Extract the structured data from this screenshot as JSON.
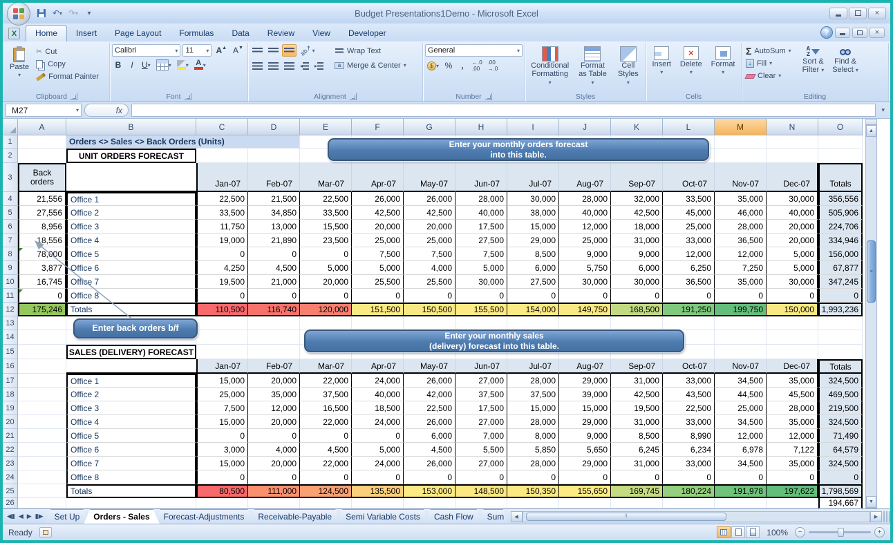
{
  "window": {
    "title": "Budget Presentations1Demo  -  Microsoft Excel"
  },
  "ribbon": {
    "tabs": [
      "Home",
      "Insert",
      "Page Layout",
      "Formulas",
      "Data",
      "Review",
      "View",
      "Developer"
    ],
    "active_tab": "Home",
    "clipboard": {
      "label": "Clipboard",
      "paste": "Paste",
      "cut": "Cut",
      "copy": "Copy",
      "format_painter": "Format Painter"
    },
    "font": {
      "label": "Font",
      "family": "Calibri",
      "size": "11",
      "bold": "B",
      "italic": "I",
      "underline": "U"
    },
    "alignment": {
      "label": "Alignment",
      "wrap": "Wrap Text",
      "merge": "Merge & Center"
    },
    "number": {
      "label": "Number",
      "format": "General"
    },
    "styles": {
      "label": "Styles",
      "conditional_1": "Conditional",
      "conditional_2": "Formatting",
      "table_1": "Format",
      "table_2": "as Table",
      "cellstyles_1": "Cell",
      "cellstyles_2": "Styles"
    },
    "cells": {
      "label": "Cells",
      "insert": "Insert",
      "delete": "Delete",
      "format": "Format"
    },
    "editing": {
      "label": "Editing",
      "autosum": "AutoSum",
      "fill": "Fill",
      "clear": "Clear",
      "sort_1": "Sort &",
      "sort_2": "Filter",
      "find_1": "Find &",
      "find_2": "Select"
    }
  },
  "formula_bar": {
    "name_box": "M27",
    "fx": "fx",
    "formula": ""
  },
  "spreadsheet": {
    "columns": [
      "A",
      "B",
      "C",
      "D",
      "E",
      "F",
      "G",
      "H",
      "I",
      "J",
      "K",
      "L",
      "M",
      "N",
      "O"
    ],
    "selected_column": "M",
    "title_cell": "Orders <> Sales <> Back Orders (Units)",
    "months": [
      "Jan-07",
      "Feb-07",
      "Mar-07",
      "Apr-07",
      "May-07",
      "Jun-07",
      "Jul-07",
      "Aug-07",
      "Sep-07",
      "Oct-07",
      "Nov-07",
      "Dec-07"
    ],
    "totals_header": "Totals",
    "unit_orders": {
      "section_title": "UNIT ORDERS FORECAST",
      "back_orders_header": "Back orders",
      "rows": [
        {
          "office": "Office 1",
          "back_orders": "21,556",
          "values": [
            "22,500",
            "21,500",
            "22,500",
            "26,000",
            "26,000",
            "28,000",
            "30,000",
            "28,000",
            "32,000",
            "33,500",
            "35,000",
            "30,000"
          ],
          "total": "356,556"
        },
        {
          "office": "Office 2",
          "back_orders": "27,556",
          "values": [
            "33,500",
            "34,850",
            "33,500",
            "42,500",
            "42,500",
            "40,000",
            "38,000",
            "40,000",
            "42,500",
            "45,000",
            "46,000",
            "40,000"
          ],
          "total": "505,906"
        },
        {
          "office": "Office 3",
          "back_orders": "8,956",
          "values": [
            "11,750",
            "13,000",
            "15,500",
            "20,000",
            "20,000",
            "17,500",
            "15,000",
            "12,000",
            "18,000",
            "25,000",
            "28,000",
            "20,000"
          ],
          "total": "224,706"
        },
        {
          "office": "Office 4",
          "back_orders": "18,556",
          "values": [
            "19,000",
            "21,890",
            "23,500",
            "25,000",
            "25,000",
            "27,500",
            "29,000",
            "25,000",
            "31,000",
            "33,000",
            "36,500",
            "20,000"
          ],
          "total": "334,946"
        },
        {
          "office": "Office 5",
          "back_orders": "78,000",
          "values": [
            "0",
            "0",
            "0",
            "7,500",
            "7,500",
            "7,500",
            "8,500",
            "9,000",
            "9,000",
            "12,000",
            "12,000",
            "5,000"
          ],
          "total": "156,000"
        },
        {
          "office": "Office 6",
          "back_orders": "3,877",
          "values": [
            "4,250",
            "4,500",
            "5,000",
            "5,000",
            "4,000",
            "5,000",
            "6,000",
            "5,750",
            "6,000",
            "6,250",
            "7,250",
            "5,000"
          ],
          "total": "67,877"
        },
        {
          "office": "Office 7",
          "back_orders": "16,745",
          "values": [
            "19,500",
            "21,000",
            "20,000",
            "25,500",
            "25,500",
            "30,000",
            "27,500",
            "30,000",
            "30,000",
            "36,500",
            "35,000",
            "30,000"
          ],
          "total": "347,245"
        },
        {
          "office": "Office 8",
          "back_orders": "0",
          "values": [
            "0",
            "0",
            "0",
            "0",
            "0",
            "0",
            "0",
            "0",
            "0",
            "0",
            "0",
            "0"
          ],
          "total": "0"
        }
      ],
      "totals": {
        "label": "Totals",
        "back_orders": "175,246",
        "back_orders_color": "#94C75C",
        "values": [
          "110,500",
          "116,740",
          "120,000",
          "151,500",
          "150,500",
          "155,500",
          "154,000",
          "149,750",
          "168,500",
          "191,250",
          "199,750",
          "150,000"
        ],
        "colors": [
          "#F8696B",
          "#F8726C",
          "#F87E6E",
          "#FBE983",
          "#FAE983",
          "#FEEB84",
          "#FDEA84",
          "#F9E883",
          "#C1DA81",
          "#7EC97D",
          "#63BE7B",
          "#FAE983"
        ],
        "total": "1,993,236"
      }
    },
    "sales": {
      "section_title": "SALES (DELIVERY) FORECAST",
      "rows": [
        {
          "office": "Office 1",
          "values": [
            "15,000",
            "20,000",
            "22,000",
            "24,000",
            "26,000",
            "27,000",
            "28,000",
            "29,000",
            "31,000",
            "33,000",
            "34,500",
            "35,000"
          ],
          "total": "324,500"
        },
        {
          "office": "Office 2",
          "values": [
            "25,000",
            "35,000",
            "37,500",
            "40,000",
            "42,000",
            "37,500",
            "37,500",
            "39,000",
            "42,500",
            "43,500",
            "44,500",
            "45,500"
          ],
          "total": "469,500"
        },
        {
          "office": "Office 3",
          "values": [
            "7,500",
            "12,000",
            "16,500",
            "18,500",
            "22,500",
            "17,500",
            "15,000",
            "15,000",
            "19,500",
            "22,500",
            "25,000",
            "28,000"
          ],
          "total": "219,500"
        },
        {
          "office": "Office 4",
          "values": [
            "15,000",
            "20,000",
            "22,000",
            "24,000",
            "26,000",
            "27,000",
            "28,000",
            "29,000",
            "31,000",
            "33,000",
            "34,500",
            "35,000"
          ],
          "total": "324,500"
        },
        {
          "office": "Office 5",
          "values": [
            "0",
            "0",
            "0",
            "0",
            "6,000",
            "7,000",
            "8,000",
            "9,000",
            "8,500",
            "8,990",
            "12,000",
            "12,000"
          ],
          "total": "71,490"
        },
        {
          "office": "Office 6",
          "values": [
            "3,000",
            "4,000",
            "4,500",
            "5,000",
            "4,500",
            "5,500",
            "5,850",
            "5,650",
            "6,245",
            "6,234",
            "6,978",
            "7,122"
          ],
          "total": "64,579"
        },
        {
          "office": "Office 7",
          "values": [
            "15,000",
            "20,000",
            "22,000",
            "24,000",
            "26,000",
            "27,000",
            "28,000",
            "29,000",
            "31,000",
            "33,000",
            "34,500",
            "35,000"
          ],
          "total": "324,500"
        },
        {
          "office": "Office 8",
          "values": [
            "0",
            "0",
            "0",
            "0",
            "0",
            "0",
            "0",
            "0",
            "0",
            "0",
            "0",
            "0"
          ],
          "total": "0"
        }
      ],
      "totals": {
        "label": "Totals",
        "values": [
          "80,500",
          "111,000",
          "124,500",
          "135,500",
          "153,000",
          "148,500",
          "150,350",
          "155,650",
          "169,745",
          "180,224",
          "191,978",
          "197,622"
        ],
        "colors": [
          "#F8696B",
          "#F9916F",
          "#FAA173",
          "#FCCF7C",
          "#FEEA84",
          "#FBE883",
          "#FCE983",
          "#FEEB84",
          "#C4DB81",
          "#95D07E",
          "#70C37B",
          "#63BE7B"
        ],
        "total": "1,798,569"
      }
    },
    "partial_row": {
      "row": "26",
      "total_value": "194,667"
    }
  },
  "callouts": {
    "orders_line1": "Enter your monthly  orders forecast",
    "orders_line2": "into this table.",
    "back_orders": "Enter back orders b/f",
    "sales_line1": "Enter your monthly sales",
    "sales_line2": "(delivery) forecast into this table."
  },
  "sheet_tabs": {
    "items": [
      "Set Up",
      "Orders - Sales",
      "Forecast-Adjustments",
      "Receivable-Payable",
      "Semi Variable Costs",
      "Cash Flow",
      "Sum"
    ],
    "active": "Orders - Sales"
  },
  "status_bar": {
    "mode": "Ready",
    "zoom": "100%"
  },
  "colors": {
    "header_fill": "#DCE6F1",
    "title_fill": "#C9DAF1",
    "callout_blue": "#4E7CB0",
    "selected_column_fill": "#F6B45B"
  }
}
